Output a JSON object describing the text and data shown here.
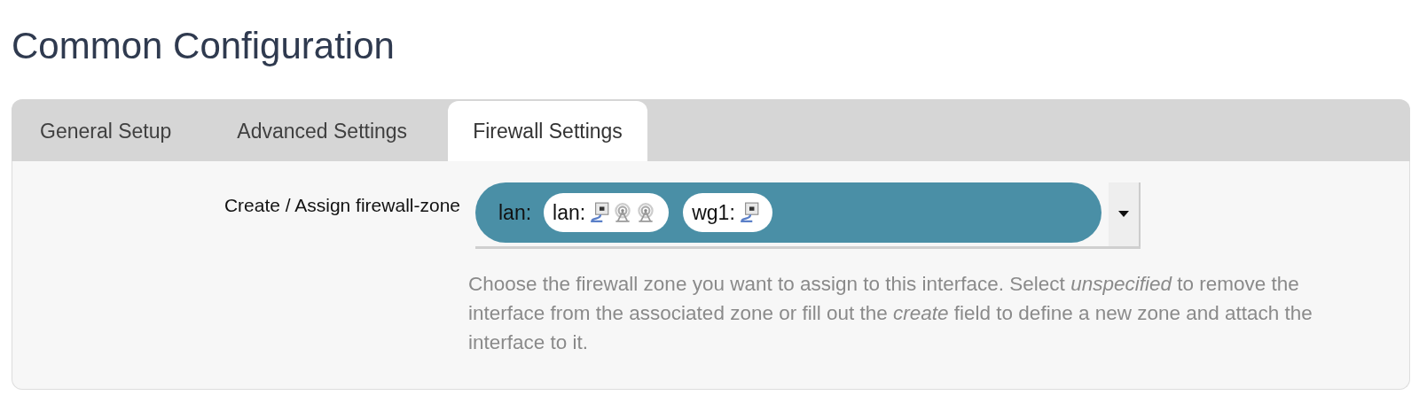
{
  "heading": "Common Configuration",
  "tabs": [
    {
      "label": "General Setup",
      "selected": false
    },
    {
      "label": "Advanced Settings",
      "selected": false
    },
    {
      "label": "Firewall Settings",
      "selected": true
    }
  ],
  "field": {
    "label": "Create / Assign firewall-zone",
    "zone": "lan:",
    "networks": [
      {
        "name": "lan:",
        "devices": [
          {
            "kind": "ethernet"
          },
          {
            "kind": "wireless"
          },
          {
            "kind": "wireless"
          }
        ]
      },
      {
        "name": "wg1:",
        "devices": [
          {
            "kind": "ethernet"
          }
        ]
      }
    ],
    "help": "Choose the firewall zone you want to assign to this interface. Select *unspecified* to remove the interface from the associated zone or fill out the *create* field to define a new zone and attach the interface to it."
  }
}
